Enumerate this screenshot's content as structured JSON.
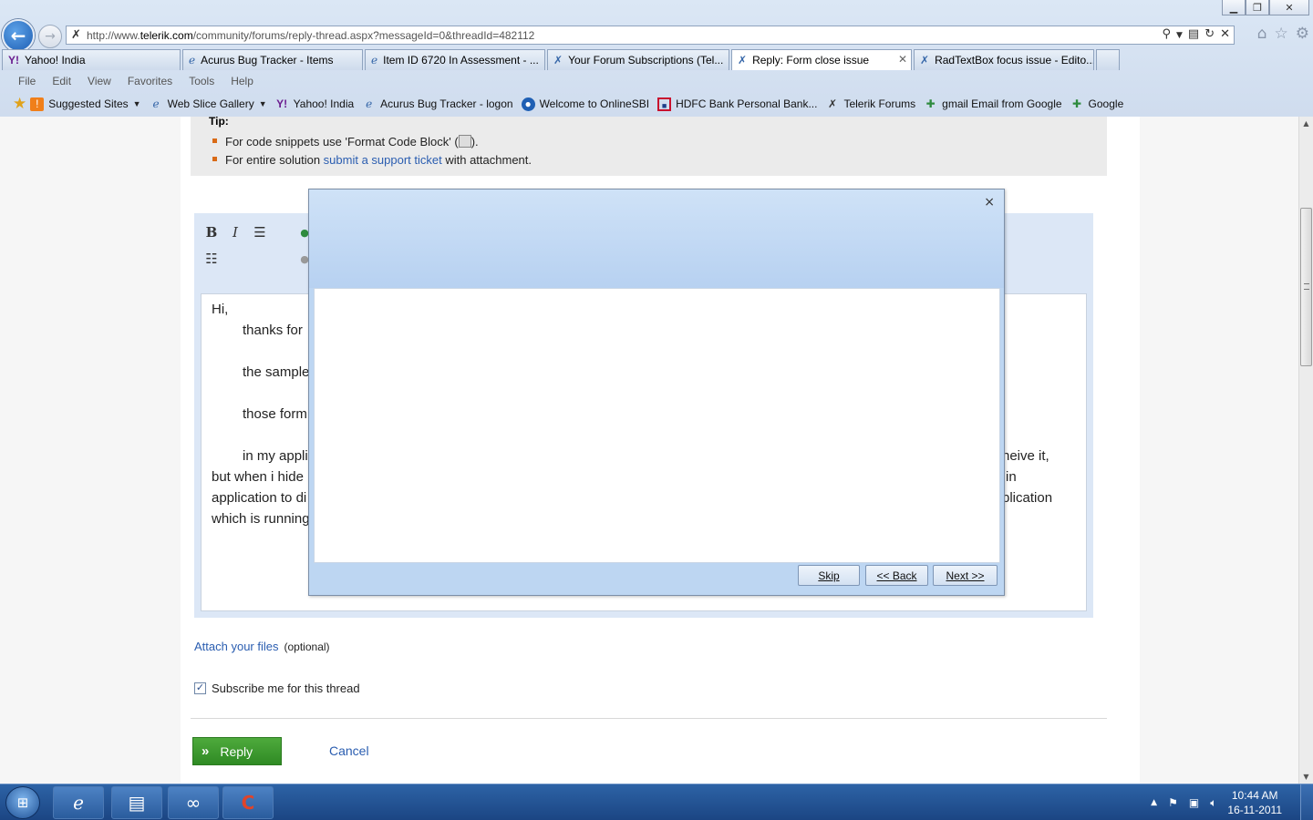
{
  "browser": {
    "address_url_prefix": "http://www.",
    "address_url_domain": "telerik.com",
    "address_url_path": "/community/forums/reply-thread.aspx?messageId=0&threadId=482112",
    "tabs": [
      {
        "label": "Yahoo! India",
        "icon": "yahoo-icon"
      },
      {
        "label": "Acurus Bug Tracker - Items",
        "icon": "ie-page-icon"
      },
      {
        "label": "Item ID 6720 In Assessment - ...",
        "icon": "ie-page-icon"
      },
      {
        "label": "Your Forum Subscriptions (Tel...",
        "icon": "telerik-icon"
      },
      {
        "label": "Reply: Form close issue",
        "icon": "telerik-icon",
        "active": true
      },
      {
        "label": "RadTextBox focus issue - Edito...",
        "icon": "telerik-icon"
      }
    ],
    "menu": [
      "File",
      "Edit",
      "View",
      "Favorites",
      "Tools",
      "Help"
    ],
    "favorites": [
      {
        "label": "Suggested Sites",
        "dropdown": true
      },
      {
        "label": "Web Slice Gallery",
        "dropdown": true
      },
      {
        "label": "Yahoo! India"
      },
      {
        "label": "Acurus Bug Tracker - logon"
      },
      {
        "label": "Welcome to OnlineSBI"
      },
      {
        "label": "HDFC Bank Personal Bank..."
      },
      {
        "label": "Telerik Forums"
      },
      {
        "label": "gmail Email from Google"
      },
      {
        "label": "Google"
      }
    ]
  },
  "page": {
    "tip_title": "Tip:",
    "tip1_prefix": "For code snippets use 'Format Code Block' (",
    "tip1_suffix": ").",
    "tip2_prefix": "For entire solution ",
    "tip2_link": "submit a support ticket",
    "tip2_suffix": " with attachment.",
    "editor_lines": {
      "l1": "Hi,",
      "l2": "thanks for",
      "l3": "the sample",
      "l4": "those form",
      "l5a": "in my appli",
      "l5b": "heive it,",
      "l6a": "but when i hide",
      "l6b": "in",
      "l7a": "application to di",
      "l7b": "plication",
      "l8": "which is running"
    },
    "attach_link": "Attach your files",
    "attach_optional": "(optional)",
    "subscribe_label": "Subscribe me for this thread",
    "subscribe_checked": true,
    "reply_label": "Reply",
    "cancel_label": "Cancel"
  },
  "dialog": {
    "close_glyph": "×",
    "skip_label": "Skip",
    "back_label": "<< Back",
    "next_label": "Next >>"
  },
  "taskbar": {
    "time": "10:44 AM",
    "date": "16-11-2011"
  },
  "colors": {
    "link": "#2a5db0",
    "reply_green": "#3a9a2e",
    "dialog_blue": "#bdd6f2",
    "taskbar": "#1b4583"
  }
}
